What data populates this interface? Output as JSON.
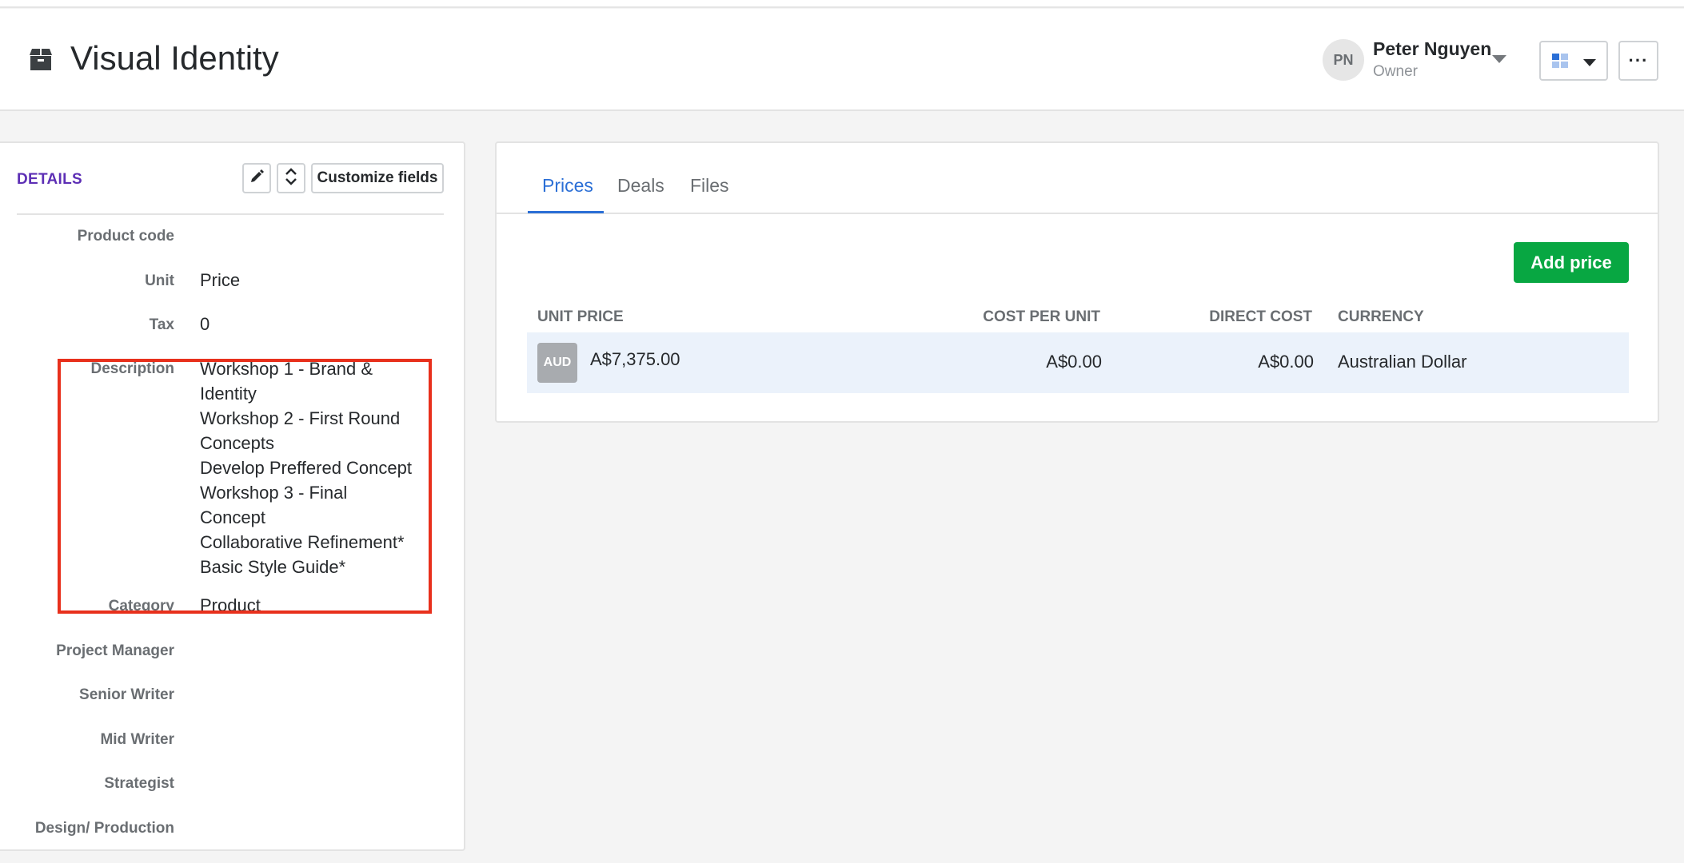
{
  "header": {
    "title": "Visual Identity",
    "product_icon": "box-icon",
    "owner": {
      "initials": "PN",
      "name": "Peter Nguyen",
      "role": "Owner"
    },
    "view_icon": "grid-view-icon",
    "more_icon": "ellipsis-icon",
    "more_label": "···"
  },
  "details": {
    "title": "DETAILS",
    "edit_icon": "pencil-icon",
    "reorder_icon": "chevron-up-down-icon",
    "customize_label": "Customize fields",
    "fields": {
      "product_code": {
        "label": "Product code",
        "value": ""
      },
      "unit": {
        "label": "Unit",
        "value": "Price"
      },
      "tax": {
        "label": "Tax",
        "value": "0"
      },
      "description": {
        "label": "Description",
        "lines": [
          "Workshop 1 - Brand & Identity",
          "Workshop 2 - First Round Concepts",
          "Develop Preffered Concept",
          "Workshop 3 - Final Concept",
          "Collaborative Refinement*",
          "Basic Style Guide*"
        ]
      },
      "category": {
        "label": "Category",
        "value": "Product"
      },
      "project_manager": {
        "label": "Project Manager",
        "value": ""
      },
      "senior_writer": {
        "label": "Senior Writer",
        "value": ""
      },
      "mid_writer": {
        "label": "Mid Writer",
        "value": ""
      },
      "strategist": {
        "label": "Strategist",
        "value": ""
      },
      "design_production": {
        "label": "Design/ Production",
        "value": ""
      }
    },
    "highlight_color": "#e8301c"
  },
  "prices_panel": {
    "tabs": [
      {
        "label": "Prices",
        "active": true
      },
      {
        "label": "Deals",
        "active": false
      },
      {
        "label": "Files",
        "active": false
      }
    ],
    "add_price_label": "Add price",
    "columns": [
      "UNIT PRICE",
      "COST PER UNIT",
      "DIRECT COST",
      "CURRENCY"
    ],
    "rows": [
      {
        "badge": "AUD",
        "unit_price": "A$7,375.00",
        "cost_per_unit": "A$0.00",
        "direct_cost": "A$0.00",
        "currency": "Australian Dollar"
      }
    ],
    "accent_color": "#2b6fd6",
    "button_color": "#08a742"
  }
}
